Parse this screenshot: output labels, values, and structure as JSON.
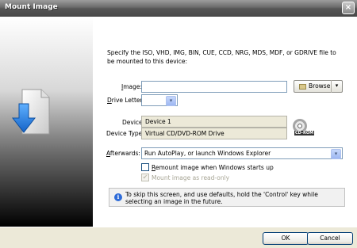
{
  "window": {
    "title": "Mount Image",
    "close_glyph": "×"
  },
  "instructions": "Specify the ISO, VHD, IMG, BIN, CUE, CCD, NRG, MDS, MDF, or GDRIVE file to be mounted to this device:",
  "image": {
    "label": "Image:",
    "value": "",
    "browse_label": "Browse",
    "browse_arrow": "▾"
  },
  "drive_letter": {
    "label": "Drive Letter:",
    "value": "",
    "arrow": "▾"
  },
  "device": {
    "label": "Device:",
    "value": "Device 1"
  },
  "device_type": {
    "label": "Device Type:",
    "value": "Virtual CD/DVD-ROM Drive",
    "badge": "CD-ROM"
  },
  "afterwards": {
    "label": "Afterwards:",
    "value": "Run AutoPlay, or launch Windows Explorer",
    "arrow": "▾"
  },
  "remount": {
    "label": "Remount image when Windows starts up",
    "checked": false
  },
  "readonly": {
    "label": "Mount image as read-only",
    "checked": true,
    "check_glyph": "✔"
  },
  "info": {
    "icon": "i",
    "text": "To skip this screen, and use defaults, hold the 'Control' key while selecting an image in the future."
  },
  "buttons": {
    "ok": "OK",
    "cancel": "Cancel"
  },
  "icons": {
    "side_illustration": "document-down-arrow-icon"
  },
  "colors": {
    "accent": "#2d6bd8",
    "arrow_blue": "#1f7ad9",
    "titlebar": "#6c6c6c"
  }
}
